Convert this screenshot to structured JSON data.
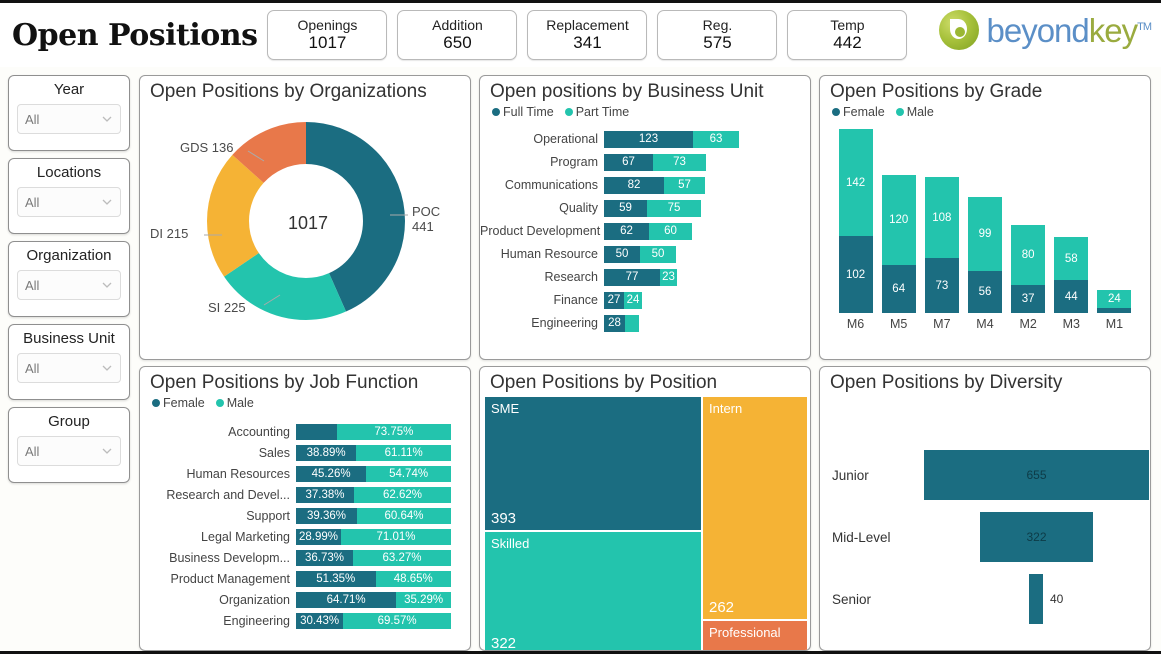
{
  "header": {
    "title": "Open Positions",
    "kpis": [
      {
        "label": "Openings",
        "value": "1017"
      },
      {
        "label": "Addition",
        "value": "650"
      },
      {
        "label": "Replacement",
        "value": "341"
      },
      {
        "label": "Reg.",
        "value": "575"
      },
      {
        "label": "Temp",
        "value": "442"
      }
    ],
    "logo": {
      "part1": "beyond",
      "part2": "key",
      "tm": "TM"
    }
  },
  "colors": {
    "dark_teal": "#1b6d81",
    "turquoise": "#23c4ad",
    "amber": "#f5b335",
    "orange": "#e8784a",
    "page_bg": "#fdfdfa",
    "card_border": "#9a9a9a"
  },
  "slicers": [
    {
      "title": "Year",
      "value": "All"
    },
    {
      "title": "Locations",
      "value": "All"
    },
    {
      "title": "Organization",
      "value": "All"
    },
    {
      "title": "Business Unit",
      "value": "All"
    },
    {
      "title": "Group",
      "value": "All"
    }
  ],
  "chart_data": [
    {
      "type": "pie",
      "title": "Open Positions by Organizations",
      "center_total": "1017",
      "labels": [
        "POC",
        "SI",
        "DI",
        "GDS"
      ],
      "values": [
        441,
        225,
        215,
        136
      ],
      "label_texts": [
        "POC 441",
        "SI 225",
        "DI 215",
        "GDS 136"
      ],
      "colors": [
        "#1b6d81",
        "#23c4ad",
        "#f5b335",
        "#e8784a"
      ],
      "legend": "none"
    },
    {
      "type": "bar",
      "title": "Open positions by Business Unit",
      "orientation": "horizontal",
      "stacked": true,
      "legend": [
        "Full Time",
        "Part Time"
      ],
      "legend_colors": [
        "#1b6d81",
        "#23c4ad"
      ],
      "categories": [
        "Operational",
        "Program",
        "Communications",
        "Quality",
        "Product Development",
        "Human Resource",
        "Research",
        "Finance",
        "Engineering"
      ],
      "series": [
        {
          "name": "Full Time",
          "values": [
            123,
            67,
            82,
            59,
            62,
            50,
            77,
            27,
            28
          ]
        },
        {
          "name": "Part Time",
          "values": [
            63,
            73,
            57,
            75,
            60,
            50,
            23,
            24,
            8
          ]
        }
      ],
      "labels_hidden": {
        "Part Time": [
          "Engineering"
        ]
      }
    },
    {
      "type": "bar",
      "title": "Open Positions by Grade",
      "orientation": "vertical",
      "stacked": true,
      "legend": [
        "Female",
        "Male"
      ],
      "legend_colors": [
        "#1b6d81",
        "#23c4ad"
      ],
      "categories": [
        "M6",
        "M5",
        "M7",
        "M4",
        "M2",
        "M3",
        "M1"
      ],
      "series": [
        {
          "name": "Female",
          "values": [
            102,
            64,
            73,
            56,
            37,
            44,
            6
          ]
        },
        {
          "name": "Male",
          "values": [
            142,
            120,
            108,
            99,
            80,
            58,
            24
          ]
        }
      ],
      "labels_hidden": {
        "Female": [
          "M1"
        ]
      },
      "ylim": [
        0,
        250
      ]
    },
    {
      "type": "bar",
      "title": "Open Positions by Job Function",
      "orientation": "horizontal",
      "stacked": true,
      "normalized": "100%",
      "legend": [
        "Female",
        "Male"
      ],
      "legend_colors": [
        "#1b6d81",
        "#23c4ad"
      ],
      "categories": [
        "Accounting",
        "Sales",
        "Human Resources",
        "Research and Devel...",
        "Support",
        "Legal Marketing",
        "Business Developm...",
        "Product Management",
        "Organization",
        "Engineering"
      ],
      "series": [
        {
          "name": "Female",
          "values": [
            26.25,
            38.89,
            45.26,
            37.38,
            39.36,
            28.99,
            36.73,
            51.35,
            64.71,
            30.43
          ],
          "labels": [
            "",
            "38.89%",
            "45.26%",
            "37.38%",
            "39.36%",
            "28.99%",
            "36.73%",
            "51.35%",
            "64.71%",
            "30.43%"
          ]
        },
        {
          "name": "Male",
          "values": [
            73.75,
            61.11,
            54.74,
            62.62,
            60.64,
            71.01,
            63.27,
            48.65,
            35.29,
            69.57
          ],
          "labels": [
            "73.75%",
            "61.11%",
            "54.74%",
            "62.62%",
            "60.64%",
            "71.01%",
            "63.27%",
            "48.65%",
            "35.29%",
            "69.57%"
          ]
        }
      ]
    },
    {
      "type": "heatmap",
      "subtype": "treemap",
      "title": "Open Positions by Position",
      "tiles": [
        {
          "name": "SME",
          "value": "393",
          "color": "#1b6d81"
        },
        {
          "name": "Skilled",
          "value": "322",
          "color": "#23c4ad"
        },
        {
          "name": "Intern",
          "value": "262",
          "color": "#f5b335"
        },
        {
          "name": "Professional",
          "value": "",
          "color": "#e8784a"
        }
      ]
    },
    {
      "type": "bar",
      "subtype": "funnel",
      "title": "Open Positions by Diversity",
      "categories": [
        "Junior",
        "Mid-Level",
        "Senior"
      ],
      "values": [
        655,
        322,
        40
      ],
      "value_labels": [
        "655",
        "322",
        "40"
      ],
      "color": "#1b6d81"
    }
  ]
}
